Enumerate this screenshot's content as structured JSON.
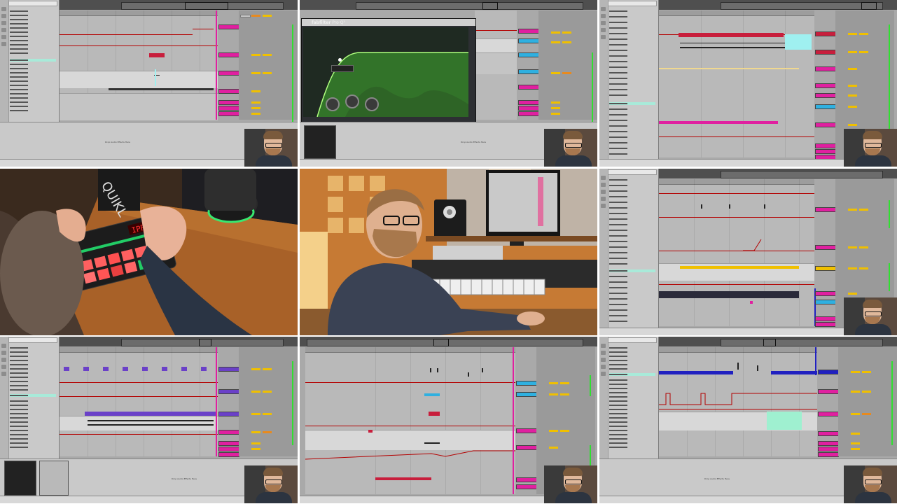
{
  "grid": {
    "cells": [
      {
        "id": "tl",
        "kind": "daw-arrangement",
        "drop_text": "Drop Audio Effects Here"
      },
      {
        "id": "tm",
        "kind": "daw-plugin",
        "plugin_brand": "fabfilter",
        "plugin_name": "Pro·Q³",
        "drop_text": "Drop Audio Effects Here"
      },
      {
        "id": "tr",
        "kind": "daw-arrangement",
        "drop_text": ""
      },
      {
        "id": "ml",
        "kind": "photo-hands-on-drum-machine",
        "device_label": "IPR"
      },
      {
        "id": "mm",
        "kind": "photo-producer-at-desk"
      },
      {
        "id": "mr",
        "kind": "daw-arrangement",
        "drop_text": ""
      },
      {
        "id": "bl",
        "kind": "daw-arrangement",
        "drop_text": "Drop Audio Effects Here"
      },
      {
        "id": "bm",
        "kind": "daw-arrangement",
        "drop_text": ""
      },
      {
        "id": "br",
        "kind": "daw-arrangement",
        "drop_text": "Drop Audio Effects Here"
      }
    ]
  },
  "colors": {
    "daw_background": "#a9a9a9",
    "browser_selection": "#a8ead9",
    "playhead_magenta": "#e020a0",
    "automation_red": "#b40000",
    "mixer_yellow": "#f0c000",
    "mixer_orange": "#e88a1e",
    "meter_green": "#30e030",
    "clip_purple": "#6a40c8",
    "clip_blue": "#2020c0",
    "clip_cyan": "#9ff0f0",
    "clip_red": "#c81e3c"
  },
  "icons": [
    "webcam-presenter",
    "mixer-fader",
    "browser-item"
  ]
}
